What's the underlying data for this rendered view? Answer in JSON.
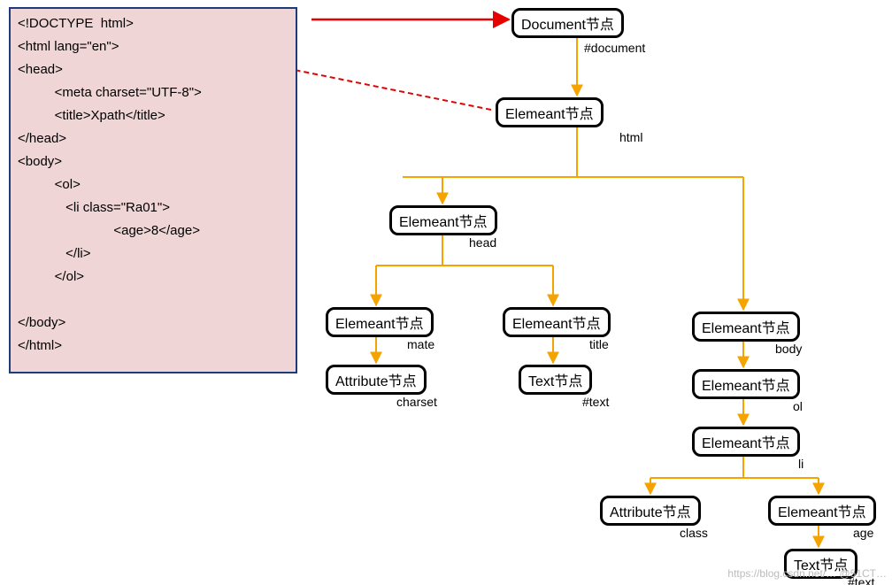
{
  "code": {
    "lines": [
      "<!DOCTYPE  html>",
      "<html lang=\"en\">",
      "<head>",
      "          <meta charset=\"UTF-8\">",
      "          <title>Xpath</title>",
      "</head>",
      "<body>",
      "          <ol>",
      "             <li class=\"Ra01\">",
      "                          <age>8</age>",
      "             </li>",
      "          </ol>",
      "",
      "</body>",
      "</html>"
    ]
  },
  "nodes": {
    "document": {
      "text": "Document节点",
      "label": "#document"
    },
    "html": {
      "text": "Elemeant节点",
      "label": "html"
    },
    "head": {
      "text": "Elemeant节点",
      "label": "head"
    },
    "mate": {
      "text": "Elemeant节点",
      "label": "mate"
    },
    "title": {
      "text": "Elemeant节点",
      "label": "title"
    },
    "attr_charset": {
      "text": "Attribute节点",
      "label": "charset"
    },
    "text_title": {
      "text": "Text节点",
      "label": "#text"
    },
    "body": {
      "text": "Elemeant节点",
      "label": "body"
    },
    "ol": {
      "text": "Elemeant节点",
      "label": "ol"
    },
    "li": {
      "text": "Elemeant节点",
      "label": "li"
    },
    "attr_class": {
      "text": "Attribute节点",
      "label": "class"
    },
    "age": {
      "text": "Elemeant节点",
      "label": "age"
    },
    "text_age": {
      "text": "Text节点",
      "label": "#text"
    }
  },
  "watermark": "https://blog.csdn.net/… @51CT…"
}
